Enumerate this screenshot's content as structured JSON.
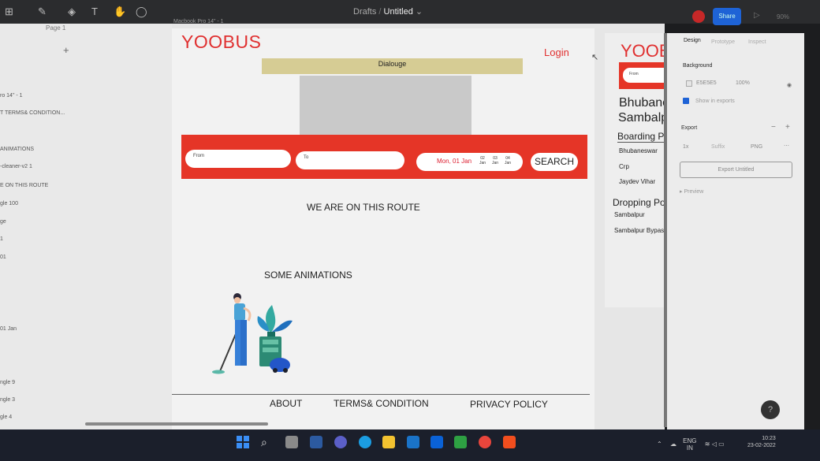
{
  "figma": {
    "path_project": "Drafts",
    "path_separator": "/",
    "path_file": "Untitled",
    "path_caret": "⌄",
    "share_label": "Share",
    "zoom": "90%"
  },
  "layers": {
    "page_label": "Page 1",
    "add_icon": "+",
    "items": [
      "ro 14\" - 1",
      "T TERMS& CONDITION...",
      "ANIMATIONS",
      "-cleaner-v2 1",
      "E ON THIS ROUTE",
      "gle 100",
      "ge",
      "1",
      "01",
      "01 Jan",
      "ngle 9",
      "ngle 3",
      "gle 4"
    ]
  },
  "canvas": {
    "frame_label": "Macbook Pro 14\" - 1",
    "cursor_icon": "↖"
  },
  "site": {
    "logo": "YOOBUS",
    "login": "Login",
    "dialog": "Dialouge",
    "search": {
      "from_placeholder": "From",
      "to_placeholder": "To",
      "date": "Mon, 01 Jan",
      "date_chips": [
        {
          "day": "02",
          "month": "Jan"
        },
        {
          "day": "03",
          "month": "Jan"
        },
        {
          "day": "04",
          "month": "Jan"
        }
      ],
      "button": "SEARCH"
    },
    "route_heading": "WE ARE ON THIS ROUTE",
    "animations_heading": "SOME ANIMATIONS",
    "footer": {
      "about": "ABOUT",
      "terms": "TERMS& CONDITION",
      "privacy": "PRIVACY POLICY"
    }
  },
  "frame2": {
    "logo": "YOOBU",
    "from_placeholder": "From",
    "city1": "Bhubanes",
    "city2": "Sambalp",
    "boarding_title": "Boarding Po",
    "boarding": [
      "Bhubaneswar",
      "Crp",
      "Jaydev Vihar"
    ],
    "dropping_title": "Dropping Poi",
    "dropping": [
      "Sambalpur",
      "Sambalpur Bypass"
    ]
  },
  "design_panel": {
    "tab_design": "Design",
    "tab_prototype": "Prototype",
    "tab_inspect": "Inspect",
    "background_label": "Background",
    "bg_hex": "E5E5E5",
    "bg_opacity": "100%",
    "show_exports": "Show in exports",
    "export_label": "Export",
    "scale": "1x",
    "suffix": "Suffix",
    "format": "PNG",
    "export_button": "Export Untitled",
    "preview": "Preview",
    "help": "?"
  },
  "tray": {
    "lang": "ENG",
    "region": "IN",
    "time": "10:23",
    "date": "23-02-2022"
  },
  "colors": {
    "brand_red": "#e03030",
    "search_bar": "#e53527",
    "dialog_bg": "#d6cc94",
    "placeholder": "#c9c9c9"
  }
}
